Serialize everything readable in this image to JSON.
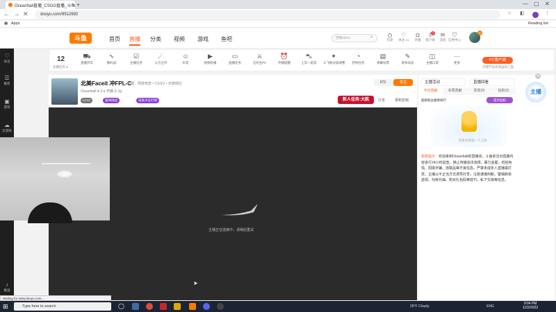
{
  "browser": {
    "tab_title": "Oceanhall直播_CSGO直播_斗鱼...",
    "url": "douyu.com/9512692",
    "bookmarks_apps": "Apps",
    "reading_list": "Reading list",
    "status_text": "Waiting for www.douyu.com..."
  },
  "header": {
    "logo_text": "斗鱼",
    "nav": [
      "首页",
      "直播",
      "分类",
      "视频",
      "游戏",
      "鱼吧"
    ],
    "search_placeholder": "搜索abcs",
    "icons": [
      {
        "label": "历史",
        "icon": "clock-icon"
      },
      {
        "label": "关注 Lv",
        "icon": "heart-icon"
      },
      {
        "label": "开播",
        "icon": "camera-icon"
      },
      {
        "label": "客户端",
        "icon": "download-icon"
      },
      {
        "label": "消息",
        "icon": "mail-icon"
      },
      {
        "label": "信用中心",
        "icon": "shield-icon"
      }
    ],
    "avatar_badge": "6",
    "nav_badge": "1"
  },
  "sidebar": [
    {
      "label": "关注",
      "icon": "heart-icon"
    },
    {
      "label": "推荐",
      "icon": "list-icon"
    },
    {
      "label": "游戏",
      "icon": "gamepad-icon"
    },
    {
      "label": "云游戏",
      "icon": "cloud-icon"
    },
    {
      "label": "推送",
      "icon": "bell-icon"
    }
  ],
  "tasks": {
    "level_number": "12",
    "level_label": "主播任务 ●",
    "items": [
      {
        "label": "直播开车",
        "icon": "car-icon"
      },
      {
        "label": "数码战",
        "icon": "wave-icon"
      },
      {
        "label": "主播任务",
        "icon": "task-icon"
      },
      {
        "label": "火力全开",
        "icon": "fire-icon"
      },
      {
        "label": "水友",
        "icon": "people-icon"
      },
      {
        "label": "视频抢播",
        "icon": "video-icon"
      },
      {
        "label": "直播任务",
        "icon": "tv-icon"
      },
      {
        "label": "全民生PK",
        "icon": "pk-icon"
      },
      {
        "label": "开播提醒",
        "icon": "alarm-icon"
      },
      {
        "label": "上车一起玩",
        "icon": "bus-icon"
      },
      {
        "label": "斗飞鹅分级调整",
        "icon": "star-icon"
      },
      {
        "label": "控制任务",
        "icon": "gauge-icon"
      },
      {
        "label": "弹幕投票",
        "icon": "chat-icon"
      },
      {
        "label": "发布动态",
        "icon": "edit-icon"
      },
      {
        "label": "主播口袋",
        "icon": "bag-icon"
      },
      {
        "label": "更多",
        "icon": "more-icon"
      }
    ],
    "pc_button": "PC客户端",
    "pc_sub": "开播节省高清画质上面"
  },
  "room": {
    "title": "北美Faceit 冲FPL-C",
    "report": "举报",
    "category": "网游竞技 • CSGO • 天梯相位",
    "meta": "Oceanhall  ♥ 3  ● 开播  ⏱ 1g",
    "tags": [
      "LV.13",
      "猫咪挑战",
      "成就点击打榜"
    ],
    "viewer_count": "672",
    "follow_label": "关注",
    "new_task": "新人任务:大航",
    "share": "分享",
    "clip": "录制剪辑"
  },
  "video": {
    "loading_text": "主播正在连接中，请稍后重试"
  },
  "right_panel": {
    "btn1": "主播活动",
    "btn2": "直播回看",
    "tabs": [
      "今日贡献",
      "本周贡献",
      "贵宾(0)",
      "钻粉(0)"
    ],
    "link_text": "超级粉丝徽章排行",
    "become_fan": "成为钻粉",
    "illustration_text": "快来争取第一个上榜",
    "notice_prefix": "系统提示：",
    "notice": "欢迎来到Oceanhall的直播间。斗鱼依法对直播内容进行24小时巡查。禁止传播违法违规、暴力血腥、低俗色情、招嫖诈骗、违禁品等不良信息。严禁未成年人直播或打赏。主播以不正当方式诱导打赏，注意谨慎判断。警惕刷单返现、代练代抽、购买礼包码等技巧，私下交易等信息。",
    "promo_text": "主播"
  },
  "windows": {
    "search_placeholder": "Type here to search",
    "weather": "28°F  Cloudy",
    "tray": "ENG",
    "time": "9:04 PM",
    "date": "1/22/2022"
  }
}
